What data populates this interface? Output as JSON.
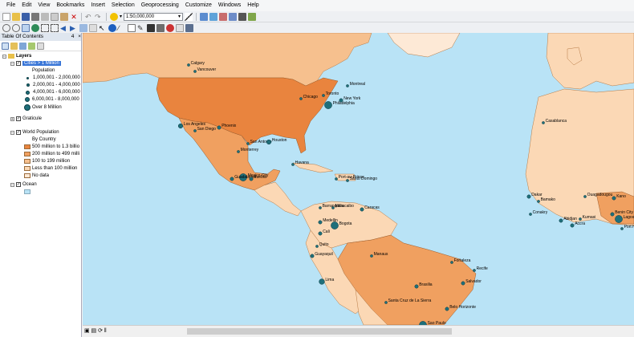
{
  "menu": [
    "File",
    "Edit",
    "View",
    "Bookmarks",
    "Insert",
    "Selection",
    "Geoprocessing",
    "Customize",
    "Windows",
    "Help"
  ],
  "toolbar": {
    "scale": "1:50,000,000"
  },
  "toc": {
    "title": "Table Of Contents",
    "pin": "4",
    "close": "×",
    "layers_root": "Layers",
    "cities_layer": "Cities > 1 Million",
    "population_header": "Population",
    "population_classes": [
      "1,000,001 - 2,000,000",
      "2,000,001 - 4,000,000",
      "4,000,001 - 6,000,000",
      "6,000,001 - 8,000,000",
      "Over 8 Million"
    ],
    "graticule_layer": "Graticule",
    "world_pop_layer": "World Population",
    "by_country": "By Country",
    "pop_classes": [
      "500 million to 1.3 billio",
      "200 million to 499 milli",
      "100 to 199 million",
      "Less than 100 million",
      "No data"
    ],
    "ocean_layer": "Ocean"
  },
  "colors": {
    "ocean": "#b9e3f6",
    "pop_500m_plus": "#e9843e",
    "pop_200_499m": "#f0a060",
    "pop_100_199m": "#f6c08e",
    "pop_under_100m": "#fbd8b5",
    "no_data": "#fde9d6",
    "city": "#1f6f7a"
  },
  "cities": [
    {
      "name": "Vancouver"
    },
    {
      "name": "Calgary"
    },
    {
      "name": "Montreal"
    },
    {
      "name": "Toronto"
    },
    {
      "name": "Chicago"
    },
    {
      "name": "New York"
    },
    {
      "name": "Philadelphia"
    },
    {
      "name": "Los Angeles"
    },
    {
      "name": "San Diego"
    },
    {
      "name": "Phoenix"
    },
    {
      "name": "San Antonio"
    },
    {
      "name": "Houston"
    },
    {
      "name": "Monterrey"
    },
    {
      "name": "Havana"
    },
    {
      "name": "Mexico City"
    },
    {
      "name": "Guadalajara"
    },
    {
      "name": "Puebla"
    },
    {
      "name": "Port-au-Prince"
    },
    {
      "name": "Santo Domingo"
    },
    {
      "name": "Maracaibo"
    },
    {
      "name": "Caracas"
    },
    {
      "name": "Barranquilla"
    },
    {
      "name": "Medellin"
    },
    {
      "name": "Bogota"
    },
    {
      "name": "Cali"
    },
    {
      "name": "Quito"
    },
    {
      "name": "Guayaquil"
    },
    {
      "name": "Manaus"
    },
    {
      "name": "Fortaleza"
    },
    {
      "name": "Recife"
    },
    {
      "name": "Salvador"
    },
    {
      "name": "Lima"
    },
    {
      "name": "Brasilia"
    },
    {
      "name": "Santa Cruz de La Sierra"
    },
    {
      "name": "Belo Horizonte"
    },
    {
      "name": "Sao Paulo"
    },
    {
      "name": "Casablanca"
    },
    {
      "name": "Dakar"
    },
    {
      "name": "Bamako"
    },
    {
      "name": "Ouagadougou"
    },
    {
      "name": "Kano"
    },
    {
      "name": "Conakry"
    },
    {
      "name": "Kumasi"
    },
    {
      "name": "Abidjan"
    },
    {
      "name": "Lagos"
    },
    {
      "name": "Benin City"
    },
    {
      "name": "Port Harcourt"
    },
    {
      "name": "Accra"
    }
  ],
  "status_text": ""
}
